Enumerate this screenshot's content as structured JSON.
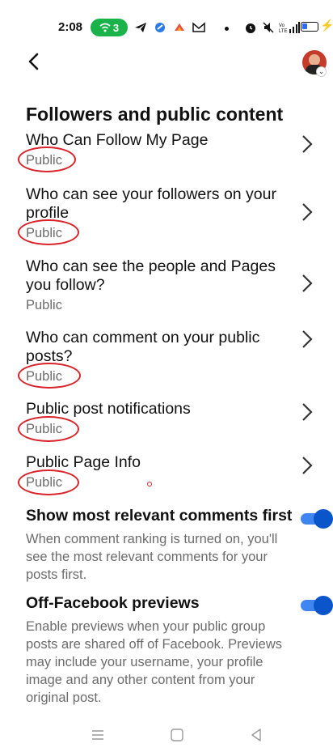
{
  "status_bar": {
    "time": "2:08",
    "hotspot_count": "3",
    "accent": "#19b34a"
  },
  "header": {
    "back_icon": "chevron-left-icon",
    "avatar": "profile-avatar"
  },
  "section": {
    "title": "Followers and public content"
  },
  "settings": [
    {
      "title": "Who Can Follow My Page",
      "value": "Public"
    },
    {
      "title": "Who can see your followers on your profile",
      "value": "Public"
    },
    {
      "title": "Who can see the people and Pages you follow?",
      "value": "Public"
    },
    {
      "title": "Who can comment on your public posts?",
      "value": "Public"
    },
    {
      "title": "Public post notifications",
      "value": "Public"
    },
    {
      "title": "Public Page Info",
      "value": "Public"
    }
  ],
  "toggles": [
    {
      "title": "Show most relevant comments first",
      "desc": "When comment ranking is turned on, you'll see the most relevant comments for your posts first.",
      "on": true
    },
    {
      "title": "Off-Facebook previews",
      "desc": "Enable previews when your public group posts are shared off of Facebook. Previews may include your username, your profile image and any other content from your original post.",
      "on": true
    }
  ],
  "colors": {
    "toggle_on": "#0a55c9",
    "annotation": "#d8232a"
  }
}
